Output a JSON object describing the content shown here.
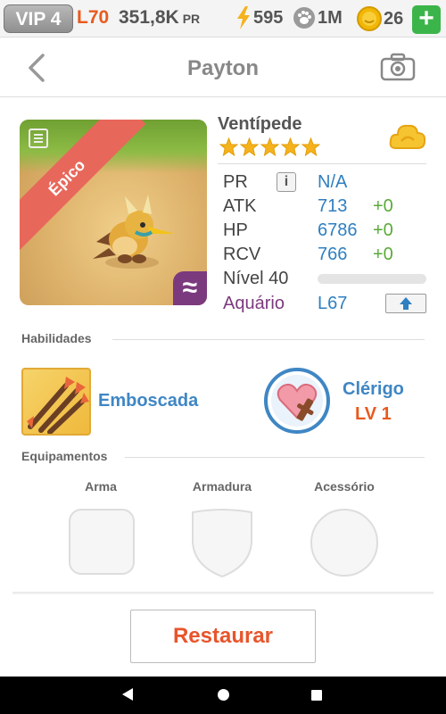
{
  "topbar": {
    "vip": "VIP 4",
    "level": "L70",
    "power": "351,8K",
    "power_suffix": "PR",
    "energy": "595",
    "paw": "1M",
    "coins": "26",
    "plus": "+"
  },
  "header": {
    "title": "Payton"
  },
  "pet": {
    "rarity": "Épico",
    "name": "Ventípede",
    "stars": 5,
    "element_badge": "≈",
    "stats": [
      {
        "label": "PR",
        "value": "N/A",
        "bonus": ""
      },
      {
        "label": "ATK",
        "value": "713",
        "bonus": "+0"
      },
      {
        "label": "HP",
        "value": "6786",
        "bonus": "+0"
      },
      {
        "label": "RCV",
        "value": "766",
        "bonus": "+0"
      }
    ],
    "info_label": "i",
    "level_label": "Nível 40",
    "level_progress": 0,
    "aquarium_label": "Aquário",
    "aquarium_level": "L67"
  },
  "skills": {
    "heading": "Habilidades",
    "skill_name": "Emboscada",
    "class_name": "Clérigo",
    "class_level": "LV 1"
  },
  "equipment": {
    "heading": "Equipamentos",
    "slots": [
      "Arma",
      "Armadura",
      "Acessório"
    ]
  },
  "actions": {
    "restore": "Restaurar"
  },
  "colors": {
    "accent_orange": "#e85a1e",
    "stat_blue": "#2f7fc1",
    "bonus_green": "#5aaa38",
    "aquarium_purple": "#7c3a7e",
    "rarity_red": "#e8675b"
  }
}
